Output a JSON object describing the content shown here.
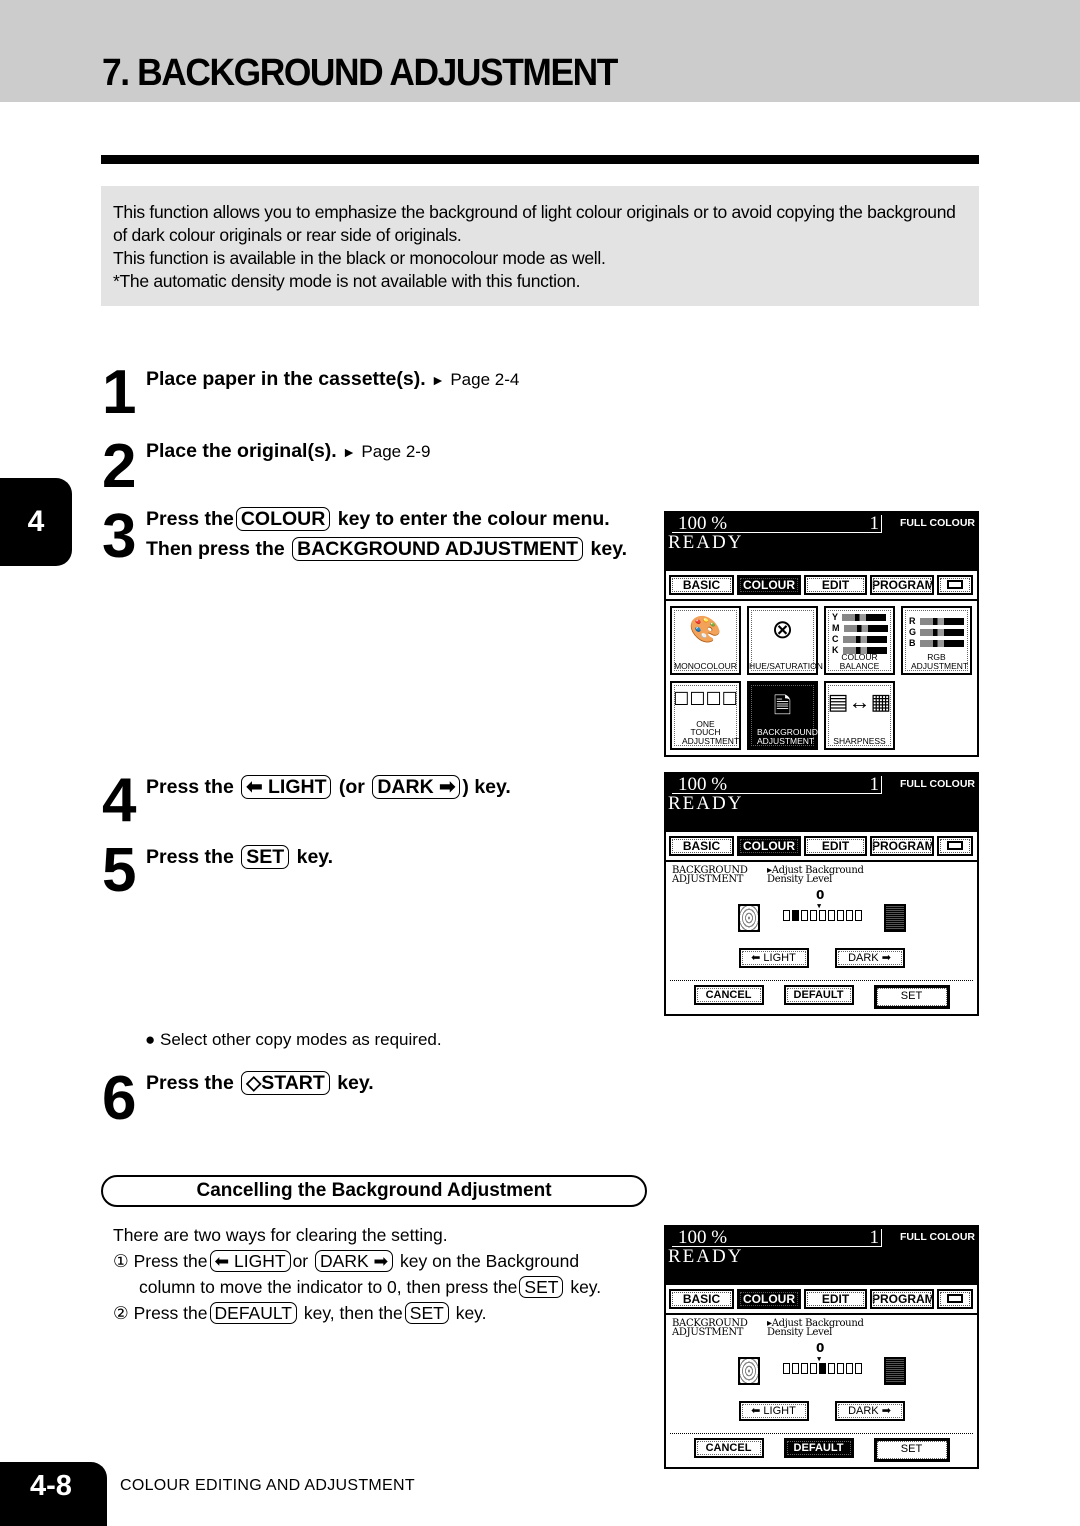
{
  "page": {
    "title": "7. BACKGROUND ADJUSTMENT",
    "chapter_tab": "4",
    "page_number": "4-8",
    "footer_label": "COLOUR EDITING AND ADJUSTMENT"
  },
  "intro": {
    "lines": [
      "This function allows you to emphasize the background of light colour originals or to avoid copying the background of dark colour originals or rear side of originals.",
      "This function is available in the black or monocolour mode as well.",
      "*The automatic density mode is not available with this function."
    ]
  },
  "steps": [
    {
      "number": "1",
      "text": "Place paper in the cassette(s).",
      "ref_arrow": "►",
      "ref": "Page 2-4"
    },
    {
      "number": "2",
      "text": "Place the original(s).",
      "ref_arrow": "►",
      "ref": "Page 2-9"
    },
    {
      "number": "3",
      "line1_pre": "Press the",
      "line1_key": "COLOUR",
      "line1_post": "key to enter the colour menu.",
      "line2_pre": "Then press the",
      "line2_key": "BACKGROUND ADJUSTMENT",
      "line2_post": "key."
    },
    {
      "number": "4",
      "pre": "Press the",
      "key1": "⬅ LIGHT",
      "mid": "(or",
      "key2": "DARK ➡",
      "post": ") key."
    },
    {
      "number": "5",
      "pre": "Press the",
      "key": "SET",
      "post": "key."
    },
    {
      "number": "6",
      "pre": "Press the",
      "key": "◇START",
      "post": "key."
    }
  ],
  "bullet_note": "● Select other copy modes as required.",
  "cancel": {
    "header": "Cancelling the Background Adjustment",
    "intro": "There are two ways for clearing the setting.",
    "way1": {
      "marker": "①",
      "pre": "Press the",
      "key1": "⬅ LIGHT",
      "mid": "or",
      "key2": "DARK ➡",
      "post": "key on the Background",
      "line2_pre": "column to move the indicator to 0, then press the",
      "line2_key": "SET",
      "line2_post": "key."
    },
    "way2": {
      "marker": "②",
      "pre": "Press the",
      "key1": "DEFAULT",
      "mid": "key, then the",
      "key2": "SET",
      "post": "key."
    }
  },
  "screens": {
    "common": {
      "zoom": "100  %",
      "count": "1",
      "mode": "FULL COLOUR",
      "status": "READY",
      "tabs": [
        "BASIC",
        "COLOUR",
        "EDIT",
        "PROGRAM"
      ],
      "active_tab": "COLOUR",
      "keyboard_icon": "keyboard-icon"
    },
    "colour_menu": {
      "items": [
        {
          "label": "MONOCOLOUR",
          "icon": "palette-icon"
        },
        {
          "label": "HUE/SATURATION",
          "icon": "colour-wheel-icon"
        },
        {
          "label": "COLOUR BALANCE",
          "icon": "ymck-bars-icon",
          "rows": [
            "Y",
            "M",
            "C",
            "K"
          ]
        },
        {
          "label": "RGB ADJUSTMENT",
          "icon": "rgb-bars-icon",
          "rows": [
            "R",
            "G",
            "B"
          ]
        },
        {
          "label": "ONE TOUCH ADJUSTMENT",
          "icon": "one-touch-icon"
        },
        {
          "label": "BACKGROUND ADJUSTMENT",
          "icon": "background-doc-icon",
          "active": true
        },
        {
          "label": "SHARPNESS",
          "icon": "sharpness-icon"
        }
      ]
    },
    "adjust": {
      "section_label_1": "BACKGROUND",
      "section_label_2": "ADJUSTMENT",
      "instruction_1": "▸Adjust Background",
      "instruction_2": "Density Level",
      "zero_label": "0",
      "light_label": "⬅ LIGHT",
      "dark_label": "DARK ➡",
      "cancel_label": "CANCEL",
      "default_label": "DEFAULT",
      "set_label": "SET",
      "scale_steps": 9
    },
    "adjust_example_level": -3,
    "cleared_example_level": 0
  },
  "colors": {
    "header_band": "#cccccc",
    "intro_box": "#e3e3e3",
    "ink": "#000000"
  }
}
